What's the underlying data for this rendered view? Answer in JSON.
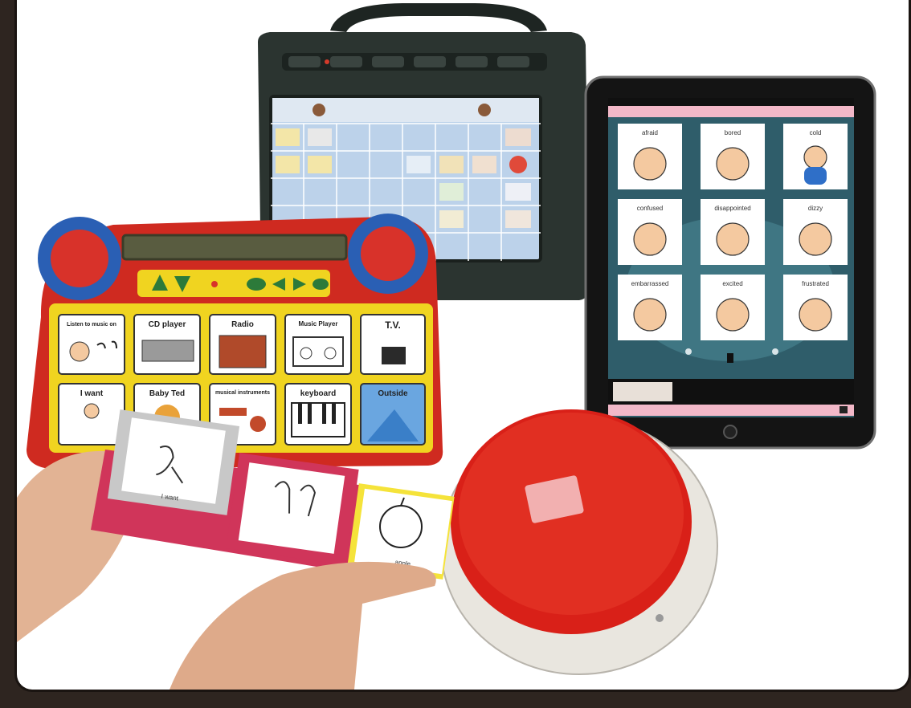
{
  "image": {
    "background_color": "#2e2520",
    "frame_color": "#ffffff",
    "subject": "Assortment of augmentative and alternative communication devices"
  },
  "talker_device": {
    "color": "#2b3430",
    "screen_color": "#bcd2ea"
  },
  "red_board": {
    "color": "#cf2a20",
    "grid_color": "#f0d420",
    "cells": [
      {
        "label": "Listen to music on"
      },
      {
        "label": "CD player"
      },
      {
        "label": "Radio"
      },
      {
        "label": "Music Player"
      },
      {
        "label": "T.V."
      },
      {
        "label": "I want"
      },
      {
        "label": "Baby Ted"
      },
      {
        "label": "musical instruments"
      },
      {
        "label": "keyboard"
      },
      {
        "label": "Outside"
      }
    ]
  },
  "tablet": {
    "frame_color": "#141414",
    "screen_color": "#2f5d6a",
    "header_color": "#f2b8c8",
    "emotion_cards": [
      {
        "label": "afraid"
      },
      {
        "label": "bored"
      },
      {
        "label": "cold"
      },
      {
        "label": "confused"
      },
      {
        "label": "disappointed"
      },
      {
        "label": "dizzy"
      },
      {
        "label": "embarrassed"
      },
      {
        "label": "excited"
      },
      {
        "label": "frustrated"
      }
    ]
  },
  "picture_strip": {
    "cards": [
      {
        "label": "I want"
      },
      {
        "label": "apple"
      }
    ],
    "card_colors": [
      "#c8c8c8",
      "#d0355a",
      "#f5e33a"
    ]
  },
  "big_button": {
    "color": "#d92018",
    "base_color": "#e9e6df"
  }
}
